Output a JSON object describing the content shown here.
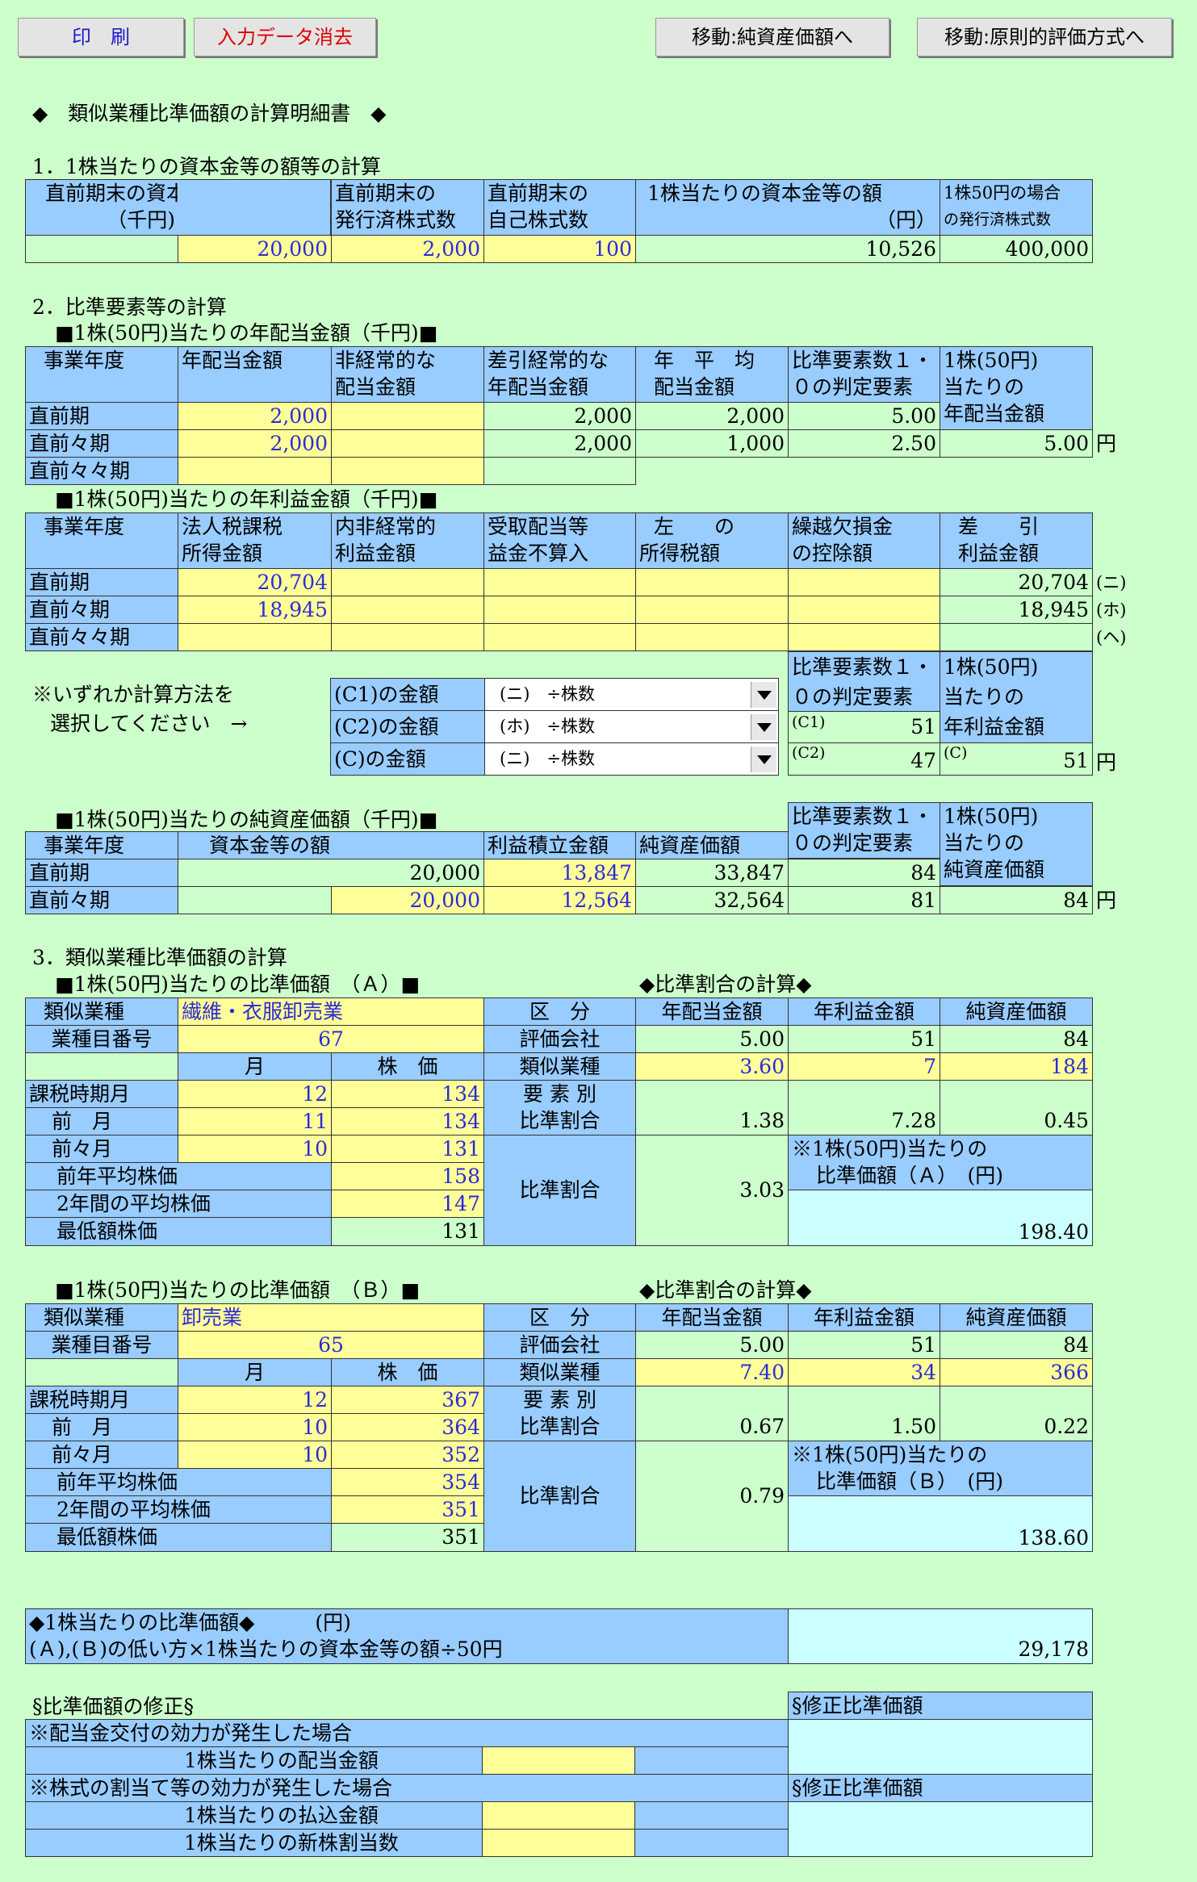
{
  "toolbar": {
    "print": "印　刷",
    "clear": "入力データ消去",
    "goto_net": "移動:純資産価額へ",
    "goto_principle": "移動:原則的評価方式へ"
  },
  "title": "◆　類似業種比準価額の計算明細書　◆",
  "s1": {
    "heading": "1．1株当たりの資本金等の額等の計算",
    "h1a": "直前期末の資本金等の額",
    "h1b": "（千円)",
    "h2a": "直前期末の",
    "h2b": "発行済株式数",
    "h3a": "直前期末の",
    "h3b": "自己株式数",
    "h4a": "1株当たりの資本金等の額",
    "h4b": "（円）",
    "h5a": "1株50円の場合",
    "h5b": "の発行済株式数",
    "v1": "20,000",
    "v2": "2,000",
    "v3": "100",
    "v4": "10,526",
    "v5": "400,000"
  },
  "s2": {
    "heading": "2．比準要素等の計算",
    "div": {
      "sub": "■1株(50円)当たりの年配当金額（千円)■",
      "h_year": "事業年度",
      "h_div": "年配当金額",
      "h_ext_a": "非経常的な",
      "h_ext_b": "配当金額",
      "h_diff_a": "差引経常的な",
      "h_diff_b": "年配当金額",
      "h_avg_a": "年　平　均",
      "h_avg_b": "配当金額",
      "h_ten_a": "比準要素数１・",
      "h_ten_b": "０の判定要素",
      "h_per_a": "1株(50円)",
      "h_per_b": "当たりの",
      "h_per_c": "年配当金額",
      "rows": [
        {
          "label": "直前期",
          "div": "2,000",
          "ext": "",
          "diff": "2,000",
          "avg": "2,000",
          "ten": "5.00"
        },
        {
          "label": "直前々期",
          "div": "2,000",
          "ext": "",
          "diff": "2,000",
          "avg": "1,000",
          "ten": "2.50"
        },
        {
          "label": "直前々々期",
          "div": "",
          "ext": "",
          "diff": "",
          "avg": "",
          "ten": ""
        }
      ],
      "result": "5.00",
      "unit": "円"
    },
    "inc": {
      "sub": "■1株(50円)当たりの年利益金額（千円)■",
      "h_year": "事業年度",
      "h_tax_a": "法人税課税",
      "h_tax_b": "所得金額",
      "h_ext_a": "内非経常的",
      "h_ext_b": "利益金額",
      "h_rcv_a": "受取配当等",
      "h_rcv_b": "益金不算入",
      "h_lt_a": "左　　の",
      "h_lt_b": "所得税額",
      "h_loss_a": "繰越欠損金",
      "h_loss_b": "の控除額",
      "h_net_a": "差　　引",
      "h_net_b": "利益金額",
      "rows": [
        {
          "label": "直前期",
          "tax": "20,704",
          "net": "20,704",
          "mark": "(ニ)"
        },
        {
          "label": "直前々期",
          "tax": "18,945",
          "net": "18,945",
          "mark": "(ホ)"
        },
        {
          "label": "直前々々期",
          "tax": "",
          "net": "",
          "mark": "(ヘ)"
        }
      ],
      "note_a": "※いずれか計算方法を",
      "note_b": "選択してください　→",
      "sel": [
        {
          "label": "(C1)の金額",
          "value": "(ニ)　÷株数"
        },
        {
          "label": "(C2)の金額",
          "value": "(ホ)　÷株数"
        },
        {
          "label": "(C)の金額",
          "value": "(ニ)　÷株数"
        }
      ],
      "h_ten_a": "比準要素数１・",
      "h_ten_b": "０の判定要素",
      "h_per_a": "1株(50円)",
      "h_per_b": "当たりの",
      "h_per_c": "年利益金額",
      "c1_tag": "(C1)",
      "c1": "51",
      "c2_tag": "(C2)",
      "c2": "47",
      "c_tag": "(C)",
      "c": "51",
      "unit": "円"
    },
    "net": {
      "sub": "■1株(50円)当たりの純資産価額（千円)■",
      "h_year": "事業年度",
      "h_cap": "資本金等の額",
      "h_ret": "利益積立金額",
      "h_net": "純資産価額",
      "h_ten_a": "比準要素数１・",
      "h_ten_b": "０の判定要素",
      "h_per_a": "1株(50円)",
      "h_per_b": "当たりの",
      "h_per_c": "純資産価額",
      "rows": [
        {
          "label": "直前期",
          "cap": "20,000",
          "ret": "13,847",
          "net": "33,847",
          "ten": "84"
        },
        {
          "label": "直前々期",
          "cap": "20,000",
          "ret": "12,564",
          "net": "32,564",
          "ten": "81"
        }
      ],
      "result": "84",
      "unit": "円"
    }
  },
  "s3": {
    "heading": "3．類似業種比準価額の計算",
    "a": {
      "sub": "■1株(50円)当たりの比準価額　（Ａ）■",
      "rsub": "◆比準割合の計算◆",
      "l_ind": "類似業種",
      "ind": "繊維・衣服卸売業",
      "l_code": "業種目番号",
      "code": "67",
      "h_month": "月",
      "h_price": "株　価",
      "rows": [
        {
          "label": "課税時期月",
          "m": "12",
          "p": "134"
        },
        {
          "label": "前　月",
          "m": "11",
          "p": "134"
        },
        {
          "label": "前々月",
          "m": "10",
          "p": "131"
        }
      ],
      "l_prev": "前年平均株価",
      "prev": "158",
      "l_two": "2年間の平均株価",
      "two": "147",
      "l_min": "最低額株価",
      "min": "131",
      "h_cls": "区　分",
      "h_div": "年配当金額",
      "h_inc": "年利益金額",
      "h_net": "純資産価額",
      "l_co": "評価会社",
      "co": [
        "5.00",
        "51",
        "84"
      ],
      "l_sim": "類似業種",
      "sim": [
        "3.60",
        "7",
        "184"
      ],
      "l_el_a": "要 素 別",
      "l_el_b": "比準割合",
      "el": [
        "1.38",
        "7.28",
        "0.45"
      ],
      "l_ratio": "比準割合",
      "ratio": "3.03",
      "res_a": "※1株(50円)当たりの",
      "res_b": "比準価額（Ａ）　(円)",
      "res": "198.40"
    },
    "b": {
      "sub": "■1株(50円)当たりの比準価額　（Ｂ）■",
      "rsub": "◆比準割合の計算◆",
      "l_ind": "類似業種",
      "ind": "卸売業",
      "l_code": "業種目番号",
      "code": "65",
      "h_month": "月",
      "h_price": "株　価",
      "rows": [
        {
          "label": "課税時期月",
          "m": "12",
          "p": "367"
        },
        {
          "label": "前　月",
          "m": "10",
          "p": "364"
        },
        {
          "label": "前々月",
          "m": "10",
          "p": "352"
        }
      ],
      "l_prev": "前年平均株価",
      "prev": "354",
      "l_two": "2年間の平均株価",
      "two": "351",
      "l_min": "最低額株価",
      "min": "351",
      "h_cls": "区　分",
      "h_div": "年配当金額",
      "h_inc": "年利益金額",
      "h_net": "純資産価額",
      "l_co": "評価会社",
      "co": [
        "5.00",
        "51",
        "84"
      ],
      "l_sim": "類似業種",
      "sim": [
        "7.40",
        "34",
        "366"
      ],
      "l_el_a": "要 素 別",
      "l_el_b": "比準割合",
      "el": [
        "0.67",
        "1.50",
        "0.22"
      ],
      "l_ratio": "比準割合",
      "ratio": "0.79",
      "res_a": "※1株(50円)当たりの",
      "res_b": "比準価額（Ｂ）　(円)",
      "res": "138.60"
    }
  },
  "final": {
    "title": "◆1株当たりの比準価額◆　　　(円)",
    "formula": "(Ａ),(Ｂ)の低い方×1株当たりの資本金等の額÷50円",
    "value": "29,178"
  },
  "mod": {
    "title": "§比準価額の修正§",
    "h1": "§修正比準価額",
    "div_event": "※配当金交付の効力が発生した場合",
    "div_per": "1株当たりの配当金額",
    "alloc_event": "※株式の割当て等の効力が発生した場合",
    "h2": "§修正比準価額",
    "pay_per": "1株当たりの払込金額",
    "new_per": "1株当たりの新株割当数"
  }
}
